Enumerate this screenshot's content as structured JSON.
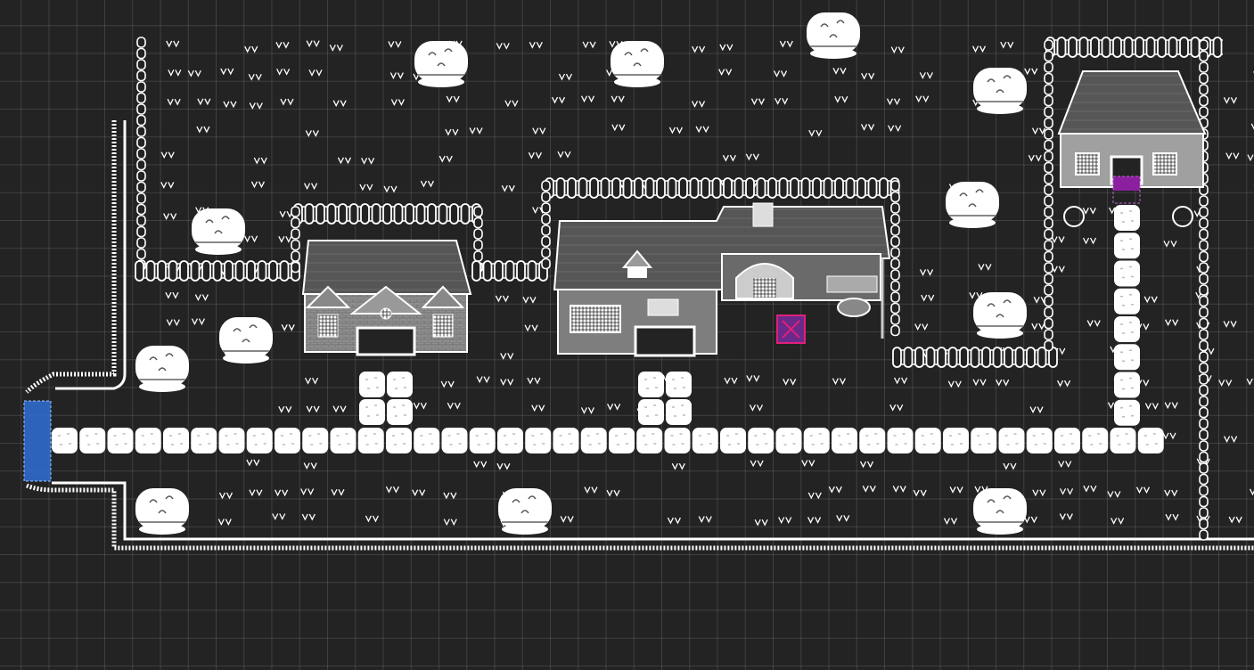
{
  "editor": {
    "title": "",
    "view": "tile-map-editor",
    "grid": "on",
    "background_color": "#232323",
    "grid_color": "#3a3a3a"
  },
  "palette": {
    "ground": "#232323",
    "white": "#ffffff",
    "roof_gray": "#5a5a5a",
    "wall_gray": "#9c9c9c",
    "spawn_marker": "#2f6fd6",
    "door_marker": "#8a1fa0",
    "selection_marker": "#e0207a",
    "selection_fill": "#6a2a8a"
  },
  "map": {
    "objects": [
      {
        "id": "house-left",
        "kind": "house-with-gables"
      },
      {
        "id": "house-center",
        "kind": "house-with-shop-sign"
      },
      {
        "id": "forge",
        "kind": "blacksmith-forge-with-anvil"
      },
      {
        "id": "house-right",
        "kind": "cottage-with-door"
      },
      {
        "id": "trees",
        "kind": "round-bush-tree",
        "count": 12
      },
      {
        "id": "main-road",
        "kind": "cobblestone-path"
      },
      {
        "id": "fences",
        "kind": "picket-fence"
      },
      {
        "id": "cliff-edge",
        "kind": "map-boundary-cliff"
      }
    ],
    "markers": [
      {
        "id": "spawn-point",
        "kind": "player-start",
        "color": "#2f6fd6"
      },
      {
        "id": "door-warp",
        "kind": "warp-tile",
        "color": "#8a1fa0"
      },
      {
        "id": "selection",
        "kind": "selected-event-tile",
        "color": "#e0207a"
      }
    ]
  }
}
